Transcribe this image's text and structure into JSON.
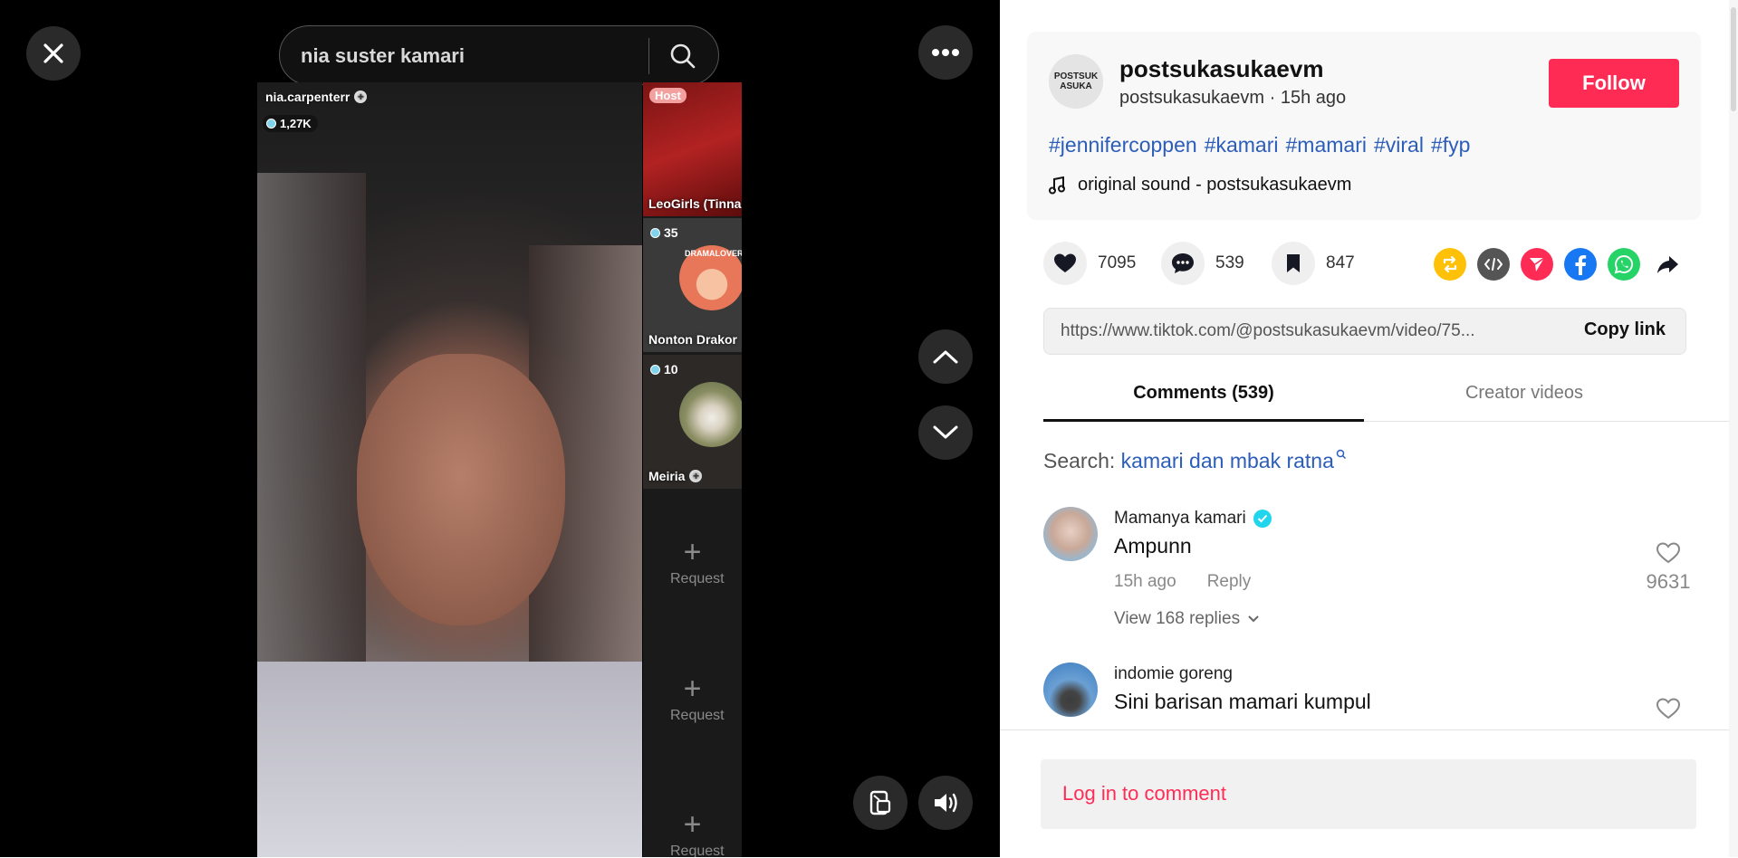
{
  "player": {
    "search_query": "nia suster kamari",
    "live": {
      "host_name": "nia.carpenterr",
      "viewer_count": "1,27K",
      "guests": [
        {
          "badge": "Host",
          "name": "LeoGirls (Tinna"
        },
        {
          "count": "35",
          "name": "Nonton Drakor",
          "avatar_text": "DRAMALOVER"
        },
        {
          "count": "10",
          "name": "Meiria"
        }
      ],
      "request_label": "Request"
    }
  },
  "post": {
    "author_name": "postsukasukaevm",
    "author_handle": "postsukasukaevm",
    "posted_ago": "15h ago",
    "avatar_text": "POSTSUK ASUKA",
    "follow_label": "Follow",
    "hashtags": [
      "#jennifercoppen",
      "#kamari",
      "#mamari",
      "#viral",
      "#fyp"
    ],
    "sound": "original sound - postsukasukaevm"
  },
  "stats": {
    "likes": "7095",
    "comments": "539",
    "saves": "847"
  },
  "share": {
    "link": "https://www.tiktok.com/@postsukasukaevm/video/75...",
    "copy_label": "Copy link",
    "icons": [
      "repost-icon",
      "embed-icon",
      "send-icon",
      "facebook-icon",
      "whatsapp-icon",
      "share-arrow-icon"
    ]
  },
  "tabs": {
    "comments": "Comments (539)",
    "creator_videos": "Creator videos"
  },
  "comments": {
    "search_prefix": "Search:",
    "search_term": "kamari dan mbak ratna",
    "items": [
      {
        "user": "Mamanya kamari",
        "verified": true,
        "text": "Ampunn",
        "time": "15h ago",
        "reply_label": "Reply",
        "likes": "9631",
        "replies": "View 168 replies"
      },
      {
        "user": "indomie goreng",
        "verified": false,
        "text": "Sini barisan mamari kumpul",
        "likes": ""
      }
    ]
  },
  "login_prompt": "Log in to comment",
  "colors": {
    "accent": "#fe2c55",
    "hashtag": "#2b5db9",
    "repost": "#ffc107",
    "facebook": "#1877f2",
    "whatsapp": "#25d366",
    "send": "#fe2c55",
    "embed": "#555555"
  }
}
